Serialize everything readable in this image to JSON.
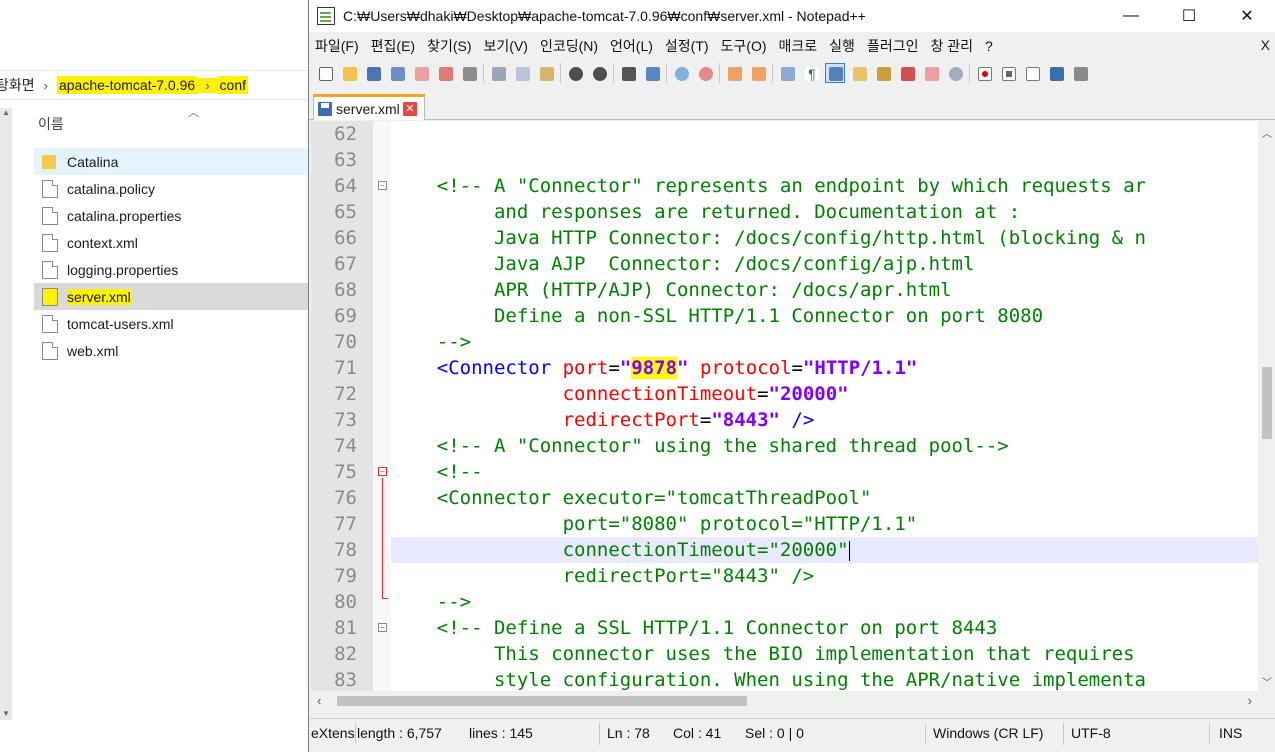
{
  "explorer": {
    "breadcrumb_prev": "탕화면",
    "breadcrumb": [
      "apache-tomcat-7.0.96",
      "conf"
    ],
    "column_name": "이름",
    "files": [
      {
        "name": "Catalina",
        "type": "folder"
      },
      {
        "name": "catalina.policy",
        "type": "file"
      },
      {
        "name": "catalina.properties",
        "type": "file"
      },
      {
        "name": "context.xml",
        "type": "file"
      },
      {
        "name": "logging.properties",
        "type": "file"
      },
      {
        "name": "server.xml",
        "type": "file"
      },
      {
        "name": "tomcat-users.xml",
        "type": "file"
      },
      {
        "name": "web.xml",
        "type": "file"
      }
    ]
  },
  "npp": {
    "title": "C:₩Users₩dhaki₩Desktop₩apache-tomcat-7.0.96₩conf₩server.xml - Notepad++",
    "window_controls": {
      "minimize": "—",
      "maximize": "☐",
      "close": "✕"
    },
    "menu": [
      "파일(F)",
      "편집(E)",
      "찾기(S)",
      "보기(V)",
      "인코딩(N)",
      "언어(L)",
      "설정(T)",
      "도구(O)",
      "매크로",
      "실행",
      "플러그인",
      "창 관리",
      "?"
    ],
    "menu_close": "X",
    "tab": {
      "label": "server.xml",
      "close": "✕"
    },
    "editor": {
      "line_numbers": [
        "62",
        "63",
        "64",
        "65",
        "66",
        "67",
        "68",
        "69",
        "70",
        "71",
        "72",
        "73",
        "74",
        "75",
        "76",
        "77",
        "78",
        "79",
        "80",
        "81",
        "82",
        "83"
      ],
      "lines": {
        "l64": "    <!-- A \"Connector\" represents an endpoint by which requests ar",
        "l65": "         and responses are returned. Documentation at :",
        "l66": "         Java HTTP Connector: /docs/config/http.html (blocking & n",
        "l67": "         Java AJP  Connector: /docs/config/ajp.html",
        "l68": "         APR (HTTP/AJP) Connector: /docs/apr.html",
        "l69": "         Define a non-SSL HTTP/1.1 Connector on port 8080",
        "l70": "    -->",
        "l71_indent": "    ",
        "l71_tag": "<Connector",
        "l71_attr1": "port",
        "l71_val1": "9878",
        "l71_attr2": "protocol",
        "l71_val2": "HTTP/1.1",
        "l72_indent": "               ",
        "l72_attr": "connectionTimeout",
        "l72_val": "20000",
        "l73_indent": "               ",
        "l73_attr": "redirectPort",
        "l73_val": "8443",
        "l73_end": "/>",
        "l74": "    <!-- A \"Connector\" using the shared thread pool-->",
        "l75": "    <!--",
        "l76": "    <Connector executor=\"tomcatThreadPool\"",
        "l77": "               port=\"8080\" protocol=\"HTTP/1.1\"",
        "l78": "               connectionTimeout=\"20000\"",
        "l79": "               redirectPort=\"8443\" />",
        "l80": "    -->",
        "l81": "    <!-- Define a SSL HTTP/1.1 Connector on port 8443",
        "l82": "         This connector uses the BIO implementation that requires",
        "l83": "         style configuration. When using the APR/native implementa"
      }
    },
    "statusbar": {
      "lang": "eXtens",
      "length": "length : 6,757",
      "lines": "lines : 145",
      "ln": "Ln : 78",
      "col": "Col : 41",
      "sel": "Sel : 0 | 0",
      "eol": "Windows (CR LF)",
      "encoding": "UTF-8",
      "mode": "INS"
    },
    "colors": {
      "comment": "#008000",
      "tag": "#0000ff",
      "attribute": "#ff0000",
      "value": "#8000ff",
      "highlight": "#ffff00",
      "tab_accent": "#f6a623"
    },
    "toolbar_icons": [
      "new-file-icon",
      "open-file-icon",
      "save-icon",
      "save-all-icon",
      "close-icon",
      "close-all-icon",
      "print-icon",
      "cut-icon",
      "copy-icon",
      "paste-icon",
      "undo-icon",
      "redo-icon",
      "find-icon",
      "replace-icon",
      "zoom-in-icon",
      "zoom-out-icon",
      "sync-v-icon",
      "sync-h-icon",
      "word-wrap-icon",
      "show-all-chars-icon",
      "indent-guide-icon",
      "doc-map-icon",
      "function-list-icon",
      "folder-workspace-icon",
      "monitor-icon",
      "record-macro-icon",
      "stop-record-icon",
      "play-macro-icon",
      "run-macro-multiple-icon",
      "save-macro-icon"
    ]
  }
}
